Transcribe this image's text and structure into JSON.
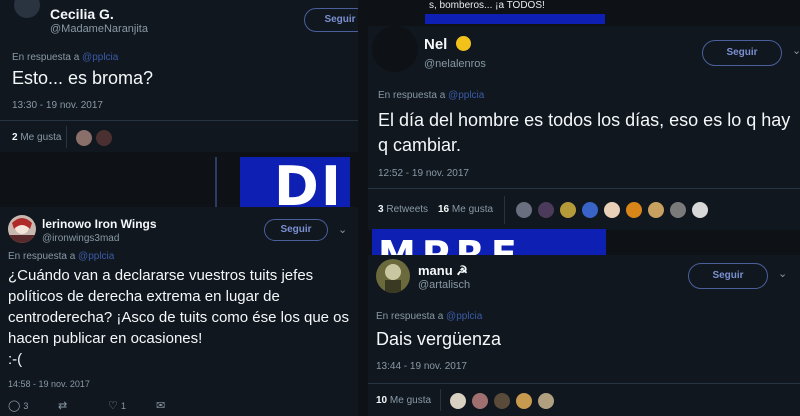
{
  "t1": {
    "name": "Cecilia G.",
    "handle": "@MadameNaranjita",
    "follow": "Seguir",
    "reply_prefix": "En respuesta a",
    "reply_to": "@pplcia",
    "text": "Esto... es broma?",
    "time": "13:30 - 19 nov. 2017",
    "likes_count": "2",
    "likes_label": "Me gusta"
  },
  "t2": {
    "name": "lerinowo Iron Wings",
    "handle": "@ironwings3mad",
    "follow": "Seguir",
    "reply_prefix": "En respuesta a",
    "reply_to": "@pplcia",
    "text": "¿Cuándo van a declararse vuestros tuits jefes políticos de derecha extrema en lugar de centroderecha? ¡Asco de tuits como ése los que os hacen publicar en ocasiones!\n:-(",
    "time": "14:58 - 19 nov. 2017",
    "replies": "3",
    "retweets": "",
    "likes": "1"
  },
  "t3": {
    "banner_text": "s, bomberos... ¡a TODOS!",
    "name": "Nel",
    "handle": "@nelalenros",
    "follow": "Seguir",
    "reply_prefix": "En respuesta a",
    "reply_to": "@pplcia",
    "text": "El día del hombre es todos los días, eso es lo q hay q cambiar.",
    "time": "12:52 - 19 nov. 2017",
    "retweets_count": "3",
    "retweets_label": "Retweets",
    "likes_count": "16",
    "likes_label": "Me gusta"
  },
  "t4": {
    "name": "manu ☭",
    "handle": "@artalisch",
    "follow": "Seguir",
    "reply_prefix": "En respuesta a",
    "reply_to": "@pplcia",
    "text": "Dais vergüenza",
    "time": "13:44 - 19 nov. 2017",
    "likes_count": "10",
    "likes_label": "Me gusta"
  },
  "banners": {
    "mid": "DI",
    "bottom": "MPRE"
  },
  "colors": {
    "background": "#0e1217",
    "panel": "#10171e",
    "banner": "#0e1fb4",
    "link": "#7b8fd1"
  }
}
